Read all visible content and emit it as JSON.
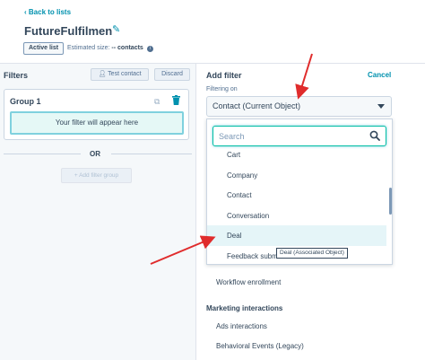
{
  "header": {
    "back_label": "Back to lists",
    "title": "FutureFulfilmen",
    "badge": "Active list",
    "estimated_label": "Estimated size:",
    "estimated_value": "-- contacts"
  },
  "left": {
    "title": "Filters",
    "test_contact": "Test contact",
    "discard": "Discard",
    "group_title": "Group 1",
    "placeholder": "Your filter will appear here",
    "or": "OR",
    "add_group": "Add filter group"
  },
  "right": {
    "title": "Add filter",
    "cancel": "Cancel",
    "filtering_on": "Filtering on",
    "object_value": "Contact (Current Object)",
    "search_placeholder": "Search",
    "dropdown_items": [
      "Cart",
      "Company",
      "Contact",
      "Conversation",
      "Deal",
      "Feedback submissions"
    ],
    "highlighted_item": "Deal",
    "tooltip": "Deal (Associated Object)",
    "below_item": "Workflow enrollment",
    "section_heading": "Marketing interactions",
    "section_items": [
      "Ads interactions",
      "Behavioral Events (Legacy)"
    ]
  },
  "colors": {
    "accent": "#0091ae",
    "arrow": "#e02c2c",
    "focus": "#00bda5"
  }
}
